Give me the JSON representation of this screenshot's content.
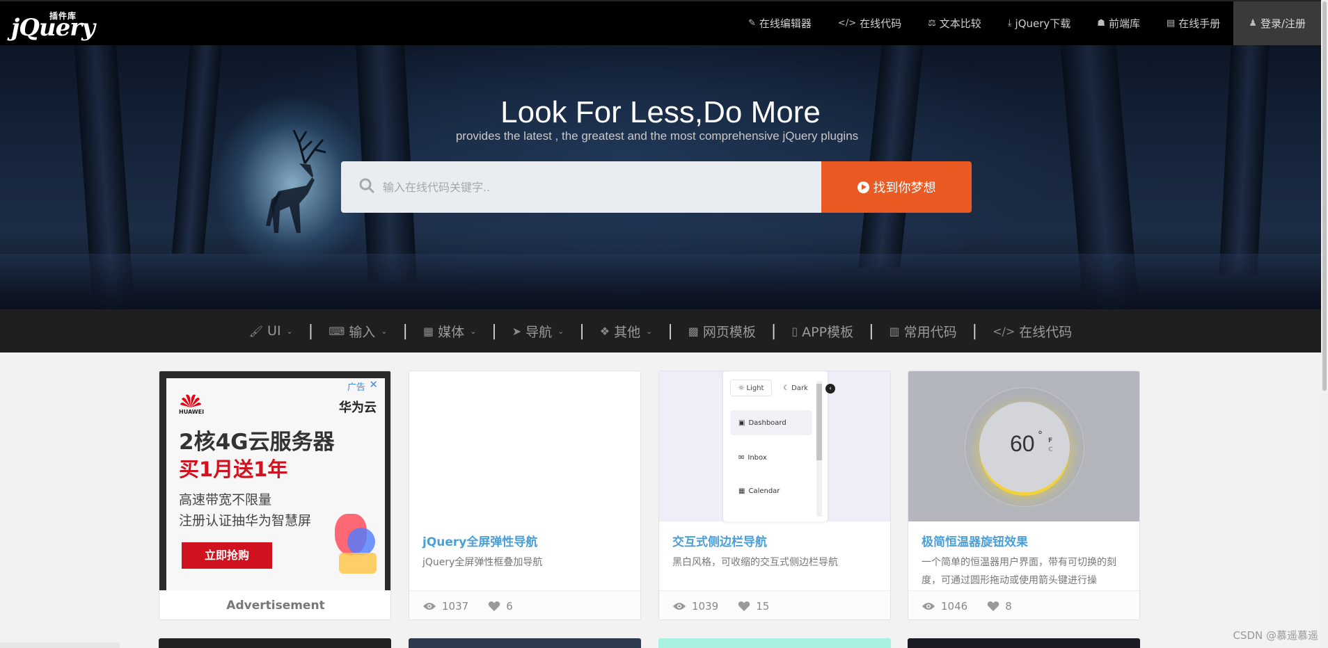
{
  "logo": {
    "main": "jQuery",
    "badge": "插件库"
  },
  "nav": [
    {
      "icon": "✎",
      "label": "在线编辑器"
    },
    {
      "icon": "</>",
      "label": "在线代码"
    },
    {
      "icon": "⚖",
      "label": "文本比较"
    },
    {
      "icon": "⤓",
      "label": "jQuery下载"
    },
    {
      "icon": "☗",
      "label": "前端库"
    },
    {
      "icon": "▤",
      "label": "在线手册"
    },
    {
      "icon": "♟",
      "label": "登录/注册"
    }
  ],
  "hero": {
    "title": "Look For Less,Do More",
    "subtitle": "provides the latest , the greatest and the most comprehensive jQuery plugins",
    "search_placeholder": "输入在线代码关键字..",
    "search_button": "找到你梦想"
  },
  "categories": [
    {
      "icon": "🖌",
      "label": "UI",
      "dropdown": true
    },
    {
      "icon": "⌨",
      "label": "输入",
      "dropdown": true
    },
    {
      "icon": "▦",
      "label": "媒体",
      "dropdown": true
    },
    {
      "icon": "➤",
      "label": "导航",
      "dropdown": true
    },
    {
      "icon": "❖",
      "label": "其他",
      "dropdown": true
    },
    {
      "icon": "▩",
      "label": "网页模板",
      "dropdown": false
    },
    {
      "icon": "▯",
      "label": "APP模板",
      "dropdown": false
    },
    {
      "icon": "▥",
      "label": "常用代码",
      "dropdown": false
    },
    {
      "icon": "</>",
      "label": "在线代码",
      "dropdown": false
    }
  ],
  "ad": {
    "tag": "广告",
    "brand": "HUAWEI",
    "cloud": "华为云",
    "headline1": "2核4G云服务器",
    "headline2": "买1月送1年",
    "line1": "高速带宽不限量",
    "line2": "注册认证抽华为智慧屏",
    "cta": "立即抢购",
    "footer": "Advertisement"
  },
  "cards": [
    {
      "title": "jQuery全屏弹性导航",
      "desc": "jQuery全屏弹性框叠加导航",
      "views": "1037",
      "likes": "6"
    },
    {
      "title": "交互式侧边栏导航",
      "desc": "黑白风格，可收缩的交互式侧边栏导航",
      "views": "1039",
      "likes": "15",
      "thumb": {
        "light": "Light",
        "dark": "Dark",
        "items": [
          "Dashboard",
          "Inbox",
          "Calendar"
        ]
      }
    },
    {
      "title": "极简恒温器旋钮效果",
      "desc": "一个简单的恒温器用户界面，带有可切换的刻度，可通过圆形拖动或使用箭头键进行操",
      "views": "1046",
      "likes": "8",
      "thumb": {
        "temp": "60",
        "deg": "°",
        "f": "F",
        "c": "C"
      }
    }
  ],
  "watermark": "CSDN @慕遥慕遥",
  "colors": {
    "accent": "#ec5a24",
    "link": "#4a9fd6",
    "topbar": "#000000",
    "catbar": "#1f1f1f"
  }
}
